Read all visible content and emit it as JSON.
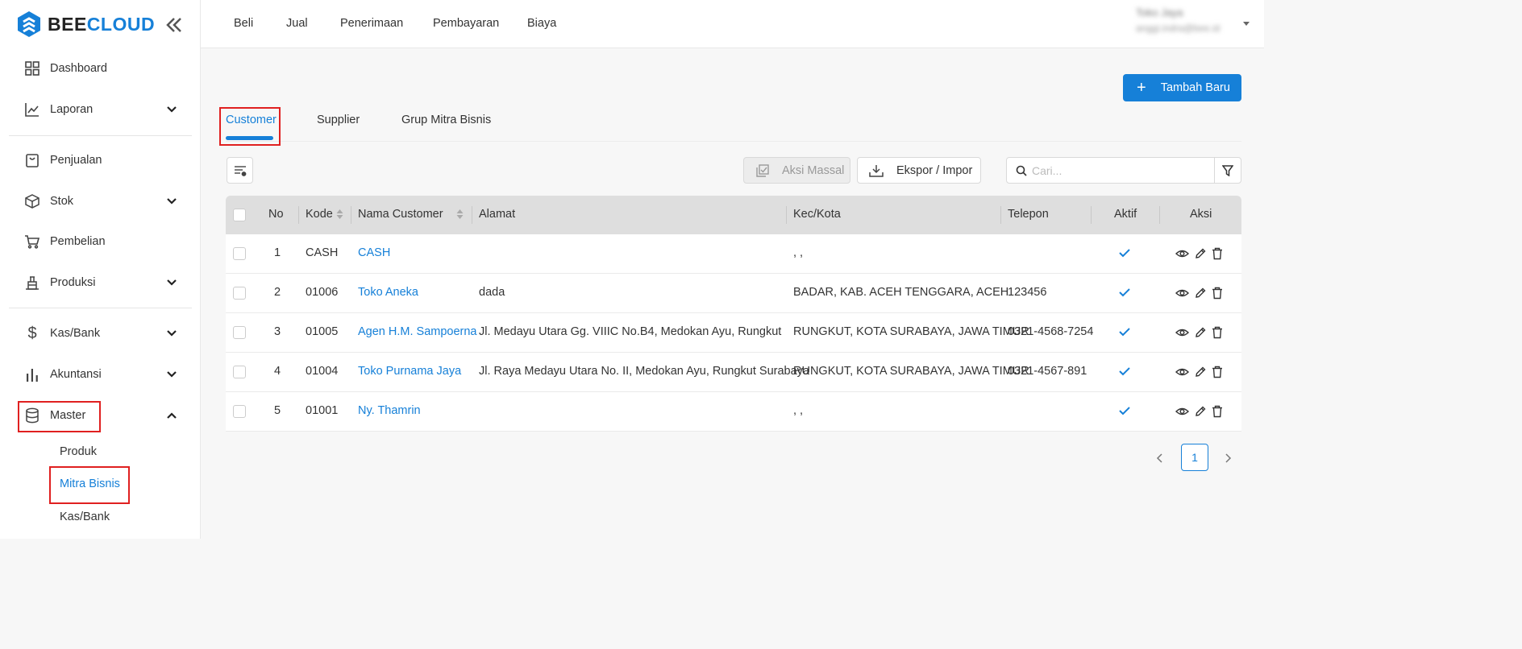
{
  "brand": {
    "name_part1": "BEE",
    "name_part2": "CLOUD",
    "accent": "#1680d8",
    "highlight": "#e02020"
  },
  "sidebar": {
    "items": [
      {
        "label": "Dashboard",
        "icon": "dashboard-grid-icon",
        "expandable": false
      },
      {
        "label": "Laporan",
        "icon": "line-chart-icon",
        "expandable": true
      },
      {
        "label": "Penjualan",
        "icon": "shopping-bag-icon",
        "expandable": false
      },
      {
        "label": "Stok",
        "icon": "box-icon",
        "expandable": true
      },
      {
        "label": "Pembelian",
        "icon": "cart-icon",
        "expandable": false
      },
      {
        "label": "Produksi",
        "icon": "factory-icon",
        "expandable": true
      },
      {
        "label": "Kas/Bank",
        "icon": "dollar-icon",
        "expandable": true
      },
      {
        "label": "Akuntansi",
        "icon": "bar-chart-icon",
        "expandable": true
      },
      {
        "label": "Master",
        "icon": "database-icon",
        "expandable": true,
        "expanded": true
      }
    ],
    "master_sub": [
      {
        "label": "Produk",
        "active": false
      },
      {
        "label": "Mitra Bisnis",
        "active": true
      },
      {
        "label": "Kas/Bank",
        "active": false
      }
    ]
  },
  "topbar": {
    "menu": [
      "Beli",
      "Jual",
      "Penerimaan",
      "Pembayaran",
      "Biaya"
    ],
    "user_name": "Toko Jaya",
    "user_email": "anggi.indra@bee.id"
  },
  "main": {
    "add_button": "Tambah Baru",
    "tabs": [
      {
        "label": "Customer",
        "active": true
      },
      {
        "label": "Supplier",
        "active": false
      },
      {
        "label": "Grup Mitra Bisnis",
        "active": false
      }
    ],
    "bulk_action": "Aksi Massal",
    "export_import": "Ekspor / Impor",
    "search_placeholder": "Cari..."
  },
  "table": {
    "columns": [
      "No",
      "Kode",
      "Nama Customer",
      "Alamat",
      "Kec/Kota",
      "Telepon",
      "Aktif",
      "Aksi"
    ],
    "rows": [
      {
        "no": "1",
        "kode": "CASH",
        "nama": "CASH",
        "alamat": "",
        "kota": ", ,",
        "telepon": "",
        "aktif": true
      },
      {
        "no": "2",
        "kode": "01006",
        "nama": "Toko Aneka",
        "alamat": "dada",
        "kota": "BADAR, KAB. ACEH TENGGARA, ACEH",
        "telepon": "123456",
        "aktif": true
      },
      {
        "no": "3",
        "kode": "01005",
        "nama": "Agen H.M. Sampoerna",
        "alamat": "Jl. Medayu Utara Gg. VIIIC No.B4, Medokan Ayu, Rungkut",
        "kota": "RUNGKUT, KOTA SURABAYA, JAWA TIMUR",
        "telepon": "0321-4568-7254",
        "aktif": true
      },
      {
        "no": "4",
        "kode": "01004",
        "nama": "Toko Purnama Jaya",
        "alamat": "Jl. Raya Medayu Utara No. II, Medokan Ayu, Rungkut Surabaya",
        "kota": "RUNGKUT, KOTA SURABAYA, JAWA TIMUR",
        "telepon": "0321-4567-891",
        "aktif": true
      },
      {
        "no": "5",
        "kode": "01001",
        "nama": "Ny. Thamrin",
        "alamat": "",
        "kota": ", ,",
        "telepon": "",
        "aktif": true
      }
    ]
  },
  "pagination": {
    "current_page": "1"
  }
}
